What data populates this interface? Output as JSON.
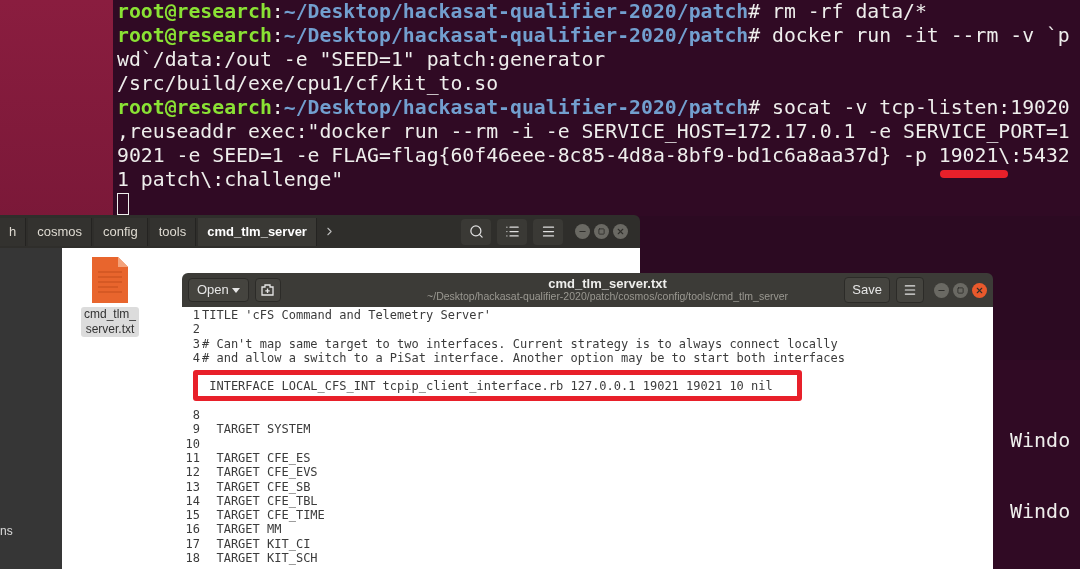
{
  "terminal": {
    "lines": [
      {
        "kind": "prompt",
        "user": "root@research",
        "colon": ":",
        "path": "~/Desktop/hackasat-qualifier-2020/patch",
        "sign": "#",
        "command": " rm -rf data/*"
      },
      {
        "kind": "prompt",
        "user": "root@research",
        "colon": ":",
        "path": "~/Desktop/hackasat-qualifier-2020/patch",
        "sign": "#",
        "command": " docker run -it --rm -v `p"
      },
      {
        "kind": "output",
        "text": "wd`/data:/out -e \"SEED=1\" patch:generator"
      },
      {
        "kind": "output",
        "text": "/src/build/exe/cpu1/cf/kit_to.so"
      },
      {
        "kind": "prompt",
        "user": "root@research",
        "colon": ":",
        "path": "~/Desktop/hackasat-qualifier-2020/patch",
        "sign": "#",
        "command": " socat -v tcp-listen:19020"
      },
      {
        "kind": "output",
        "text": ",reuseaddr exec:\"docker run --rm -i -e SERVICE_HOST=172.17.0.1 -e SERVICE_PORT=1"
      },
      {
        "kind": "output",
        "text": "9021 -e SEED=1 -e FLAG=flag{60f46eee-8c85-4d8a-8bf9-bd1c6a8aa37d} -p 19021\\:5432"
      },
      {
        "kind": "output",
        "text": "1 patch\\:challenge\""
      }
    ]
  },
  "background_terminal": {
    "lines": [
      "Windo",
      "Windo"
    ]
  },
  "file_manager": {
    "breadcrumbs": [
      {
        "label": "h",
        "selected": false
      },
      {
        "label": "cosmos",
        "selected": false
      },
      {
        "label": "config",
        "selected": false
      },
      {
        "label": "tools",
        "selected": false
      },
      {
        "label": "cmd_tlm_server",
        "selected": true
      }
    ],
    "sidebar": {
      "items": [
        {
          "label": "ns"
        }
      ]
    },
    "files": [
      {
        "name": "cmd_tlm_server.txt",
        "selected": true
      }
    ]
  },
  "editor": {
    "open_button": "Open",
    "title": "cmd_tlm_server.txt",
    "subtitle": "~/Desktop/hackasat-qualifier-2020/patch/cosmos/config/tools/cmd_tlm_server",
    "save_button": "Save",
    "lines": [
      {
        "number": "1",
        "text": "TITLE 'cFS Command and Telemetry Server'",
        "boxed": false
      },
      {
        "number": "2",
        "boxed": false
      },
      {
        "number": "3",
        "text": "# Can't map same target to two interfaces. Current strategy is to always connect locally",
        "boxed": false
      },
      {
        "number": "4",
        "text": "# and allow a switch to a PiSat interface. Another option may be to start both interfaces",
        "boxed": false
      },
      {
        "boxed": false
      },
      {
        "text": " INTERFACE LOCAL_CFS_INT tcpip_client_interface.rb 127.0.0.1 19021 19021 10 nil",
        "boxed": true
      },
      {
        "boxed": false
      },
      {
        "number": "8",
        "boxed": false
      },
      {
        "number": "9",
        "text": "  TARGET SYSTEM",
        "boxed": false
      },
      {
        "number": "10",
        "boxed": false
      },
      {
        "number": "11",
        "text": "  TARGET CFE_ES",
        "boxed": false
      },
      {
        "number": "12",
        "text": "  TARGET CFE_EVS",
        "boxed": false
      },
      {
        "number": "13",
        "text": "  TARGET CFE_SB",
        "boxed": false
      },
      {
        "number": "14",
        "text": "  TARGET CFE_TBL",
        "boxed": false
      },
      {
        "number": "15",
        "text": "  TARGET CFE_TIME",
        "boxed": false
      },
      {
        "number": "16",
        "text": "  TARGET MM",
        "boxed": false
      },
      {
        "number": "17",
        "text": "  TARGET KIT_CI",
        "boxed": false
      },
      {
        "number": "18",
        "text": "  TARGET KIT_SCH",
        "boxed": false
      }
    ]
  }
}
